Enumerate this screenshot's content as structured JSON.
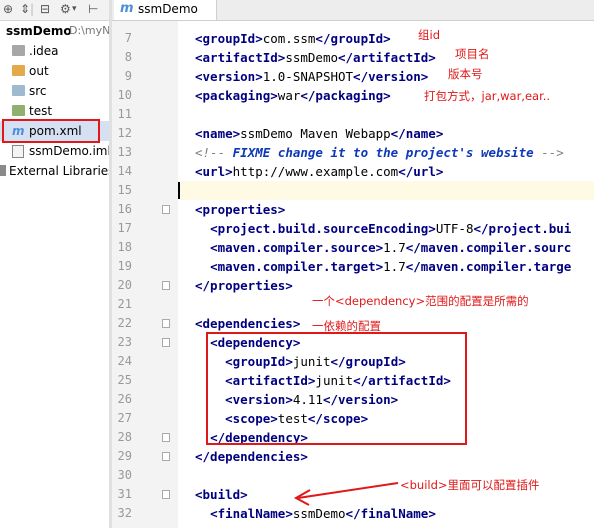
{
  "project": {
    "root_name": "ssmDemo",
    "root_path": "D:\\myN",
    "items": [
      {
        "label": ".idea",
        "icon": "folder-icon"
      },
      {
        "label": "out",
        "icon": "folder-icon"
      },
      {
        "label": "src",
        "icon": "folder-icon"
      },
      {
        "label": "test",
        "icon": "folder-icon"
      },
      {
        "label": "pom.xml",
        "icon": "maven-file-icon"
      },
      {
        "label": "ssmDemo.iml",
        "icon": "iml-file-icon"
      }
    ],
    "external_libraries": "External Libraries"
  },
  "editor": {
    "tab_label": "ssmDemo",
    "lines": [
      {
        "n": "7",
        "parts": [
          [
            "t",
            "<groupId>"
          ],
          [
            "x",
            "com.ssm"
          ],
          [
            "t",
            "</groupId>"
          ]
        ]
      },
      {
        "n": "8",
        "parts": [
          [
            "t",
            "<artifactId>"
          ],
          [
            "x",
            "ssmDemo"
          ],
          [
            "t",
            "</artifactId>"
          ]
        ]
      },
      {
        "n": "9",
        "parts": [
          [
            "t",
            "<version>"
          ],
          [
            "x",
            "1.0-SNAPSHOT"
          ],
          [
            "t",
            "</version>"
          ]
        ]
      },
      {
        "n": "10",
        "parts": [
          [
            "t",
            "<packaging>"
          ],
          [
            "x",
            "war"
          ],
          [
            "t",
            "</packaging>"
          ]
        ]
      },
      {
        "n": "11",
        "parts": []
      },
      {
        "n": "12",
        "parts": [
          [
            "t",
            "<name>"
          ],
          [
            "x",
            "ssmDemo Maven Webapp"
          ],
          [
            "t",
            "</name>"
          ]
        ]
      },
      {
        "n": "13",
        "parts": [
          [
            "c",
            "<!-- "
          ],
          [
            "k",
            "FIXME change it to the project's website"
          ],
          [
            "c",
            " -->"
          ]
        ]
      },
      {
        "n": "14",
        "parts": [
          [
            "t",
            "<url>"
          ],
          [
            "x",
            "http://www.example.com"
          ],
          [
            "t",
            "</url>"
          ]
        ]
      },
      {
        "n": "15",
        "parts": []
      },
      {
        "n": "16",
        "parts": [
          [
            "t",
            "<properties>"
          ]
        ]
      },
      {
        "n": "17",
        "parts": [
          [
            "x",
            "  "
          ],
          [
            "t",
            "<project.build.sourceEncoding>"
          ],
          [
            "x",
            "UTF-8"
          ],
          [
            "t",
            "</project.bui"
          ]
        ]
      },
      {
        "n": "18",
        "parts": [
          [
            "x",
            "  "
          ],
          [
            "t",
            "<maven.compiler.source>"
          ],
          [
            "x",
            "1.7"
          ],
          [
            "t",
            "</maven.compiler.sourc"
          ]
        ]
      },
      {
        "n": "19",
        "parts": [
          [
            "x",
            "  "
          ],
          [
            "t",
            "<maven.compiler.target>"
          ],
          [
            "x",
            "1.7"
          ],
          [
            "t",
            "</maven.compiler.targe"
          ]
        ]
      },
      {
        "n": "20",
        "parts": [
          [
            "t",
            "</properties>"
          ]
        ]
      },
      {
        "n": "21",
        "parts": []
      },
      {
        "n": "22",
        "parts": [
          [
            "t",
            "<dependencies>"
          ]
        ]
      },
      {
        "n": "23",
        "parts": [
          [
            "x",
            "  "
          ],
          [
            "t",
            "<dependency>"
          ]
        ]
      },
      {
        "n": "24",
        "parts": [
          [
            "x",
            "    "
          ],
          [
            "t",
            "<groupId>"
          ],
          [
            "x",
            "junit"
          ],
          [
            "t",
            "</groupId>"
          ]
        ]
      },
      {
        "n": "25",
        "parts": [
          [
            "x",
            "    "
          ],
          [
            "t",
            "<artifactId>"
          ],
          [
            "x",
            "junit"
          ],
          [
            "t",
            "</artifactId>"
          ]
        ]
      },
      {
        "n": "26",
        "parts": [
          [
            "x",
            "    "
          ],
          [
            "t",
            "<version>"
          ],
          [
            "x",
            "4.11"
          ],
          [
            "t",
            "</version>"
          ]
        ]
      },
      {
        "n": "27",
        "parts": [
          [
            "x",
            "    "
          ],
          [
            "t",
            "<scope>"
          ],
          [
            "x",
            "test"
          ],
          [
            "t",
            "</scope>"
          ]
        ]
      },
      {
        "n": "28",
        "parts": [
          [
            "x",
            "  "
          ],
          [
            "t",
            "</dependency>"
          ]
        ]
      },
      {
        "n": "29",
        "parts": [
          [
            "t",
            "</dependencies>"
          ]
        ]
      },
      {
        "n": "30",
        "parts": []
      },
      {
        "n": "31",
        "parts": [
          [
            "t",
            "<build>"
          ]
        ]
      },
      {
        "n": "32",
        "parts": [
          [
            "x",
            "  "
          ],
          [
            "t",
            "<finalName>"
          ],
          [
            "x",
            "ssmDemo"
          ],
          [
            "t",
            "</finalName>"
          ]
        ]
      }
    ],
    "current_line": "15"
  },
  "annotations": {
    "group_id": "组id",
    "artifact_id": "项目名",
    "version": "版本号",
    "packaging": "打包方式，jar,war,ear..",
    "dependency_scope": "一个<dependency>范围的配置是所需的",
    "dependency_config": "一依赖的配置",
    "build_plugins": "<build>里面可以配置插件"
  },
  "colors": {
    "tag": "#000080",
    "comment": "#808080",
    "annotation_red": "#e01818",
    "current_line_bg": "#fffae3",
    "maven_icon": "#4a8fd8"
  }
}
